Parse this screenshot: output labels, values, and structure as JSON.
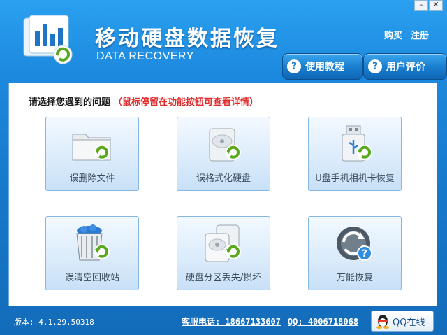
{
  "window": {
    "controls": {
      "minimize": "–",
      "close": "✕"
    }
  },
  "header": {
    "title": "移动硬盘数据恢复",
    "subtitle": "DATA RECOVERY",
    "links": {
      "buy": "购买",
      "register": "注册"
    },
    "buttons": {
      "tutorial": {
        "label": "使用教程",
        "icon": "?"
      },
      "review": {
        "label": "用户评价",
        "icon": "?"
      }
    }
  },
  "main": {
    "prompt": "请选择您遇到的问题",
    "hint": "（鼠标停留在功能按钮可查看详情）",
    "options": [
      {
        "label": "误删除文件",
        "icon": "folder-recover-icon"
      },
      {
        "label": "误格式化硬盘",
        "icon": "harddisk-recover-icon"
      },
      {
        "label": "U盘手机相机卡恢复",
        "icon": "usb-recover-icon"
      },
      {
        "label": "误清空回收站",
        "icon": "recycle-bin-icon"
      },
      {
        "label": "硬盘分区丢失/损坏",
        "icon": "partition-recover-icon"
      },
      {
        "label": "万能恢复",
        "icon": "universal-recover-icon"
      }
    ]
  },
  "status": {
    "version": "版本: 4.1.29.50318",
    "hotline": "客服电话: 18667133607",
    "qq": "QQ: 4006718068",
    "qq_button": "QQ在线"
  },
  "colors": {
    "accent": "#1a7fd0",
    "hint_red": "#e02b2b",
    "tile_border": "#86b8e4",
    "recover_green": "#5aa81e"
  }
}
